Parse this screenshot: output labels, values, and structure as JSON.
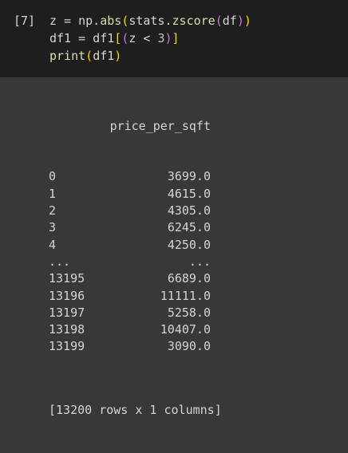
{
  "cell": {
    "prompt": "[7]",
    "code_lines": [
      [
        {
          "t": "z = np.",
          "c": "var"
        },
        {
          "t": "abs",
          "c": "fn"
        },
        {
          "t": "(",
          "c": "b1"
        },
        {
          "t": "stats.",
          "c": "var"
        },
        {
          "t": "zscore",
          "c": "fn"
        },
        {
          "t": "(",
          "c": "b2"
        },
        {
          "t": "df",
          "c": "var"
        },
        {
          "t": ")",
          "c": "b2"
        },
        {
          "t": ")",
          "c": "b1"
        }
      ],
      [
        {
          "t": "df1 = df1",
          "c": "var"
        },
        {
          "t": "[",
          "c": "b1"
        },
        {
          "t": "(",
          "c": "b2"
        },
        {
          "t": "z < ",
          "c": "var"
        },
        {
          "t": "3",
          "c": "num"
        },
        {
          "t": ")",
          "c": "b2"
        },
        {
          "t": "]",
          "c": "b1"
        }
      ],
      [
        {
          "t": "print",
          "c": "fn"
        },
        {
          "t": "(",
          "c": "b1"
        },
        {
          "t": "df1",
          "c": "var"
        },
        {
          "t": ")",
          "c": "b1"
        }
      ]
    ]
  },
  "output": {
    "column_header": "price_per_sqft",
    "rows": [
      {
        "index": "0",
        "value": "3699.0"
      },
      {
        "index": "1",
        "value": "4615.0"
      },
      {
        "index": "2",
        "value": "4305.0"
      },
      {
        "index": "3",
        "value": "6245.0"
      },
      {
        "index": "4",
        "value": "4250.0"
      },
      {
        "index": "...",
        "value": "..."
      },
      {
        "index": "13195",
        "value": "6689.0"
      },
      {
        "index": "13196",
        "value": "11111.0"
      },
      {
        "index": "13197",
        "value": "5258.0"
      },
      {
        "index": "13198",
        "value": "10407.0"
      },
      {
        "index": "13199",
        "value": "3090.0"
      }
    ],
    "summary": "[13200 rows x 1 columns]"
  },
  "colors": {
    "code_bg": "#1e1e1e",
    "output_bg": "#383838",
    "text": "#d4d4d4",
    "function": "#dcdcaa",
    "number": "#b5cea8",
    "bracket_level1": "#ffd700",
    "bracket_level2": "#da70d6"
  }
}
